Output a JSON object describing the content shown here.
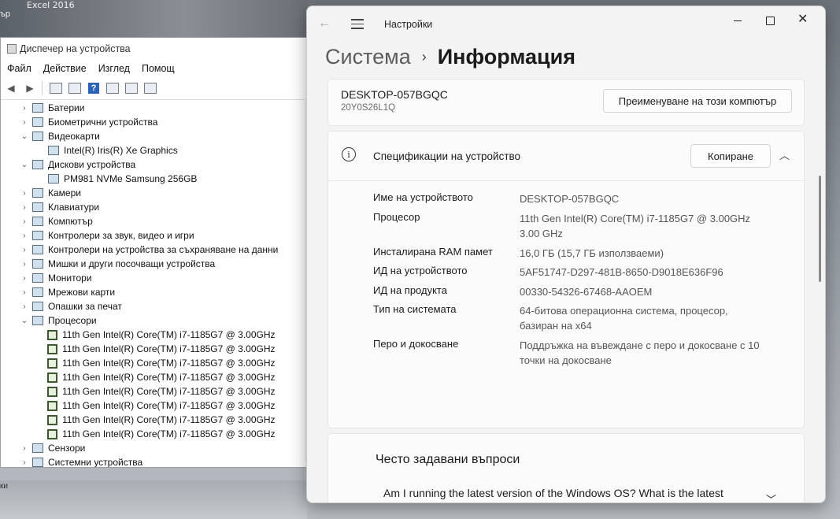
{
  "desktop": {
    "bg_text": "Excel 2016",
    "bg_text2": "ър",
    "bg_text3": "ки"
  },
  "device_manager": {
    "title": "Диспечер на устройства",
    "menu": [
      "Файл",
      "Действие",
      "Изглед",
      "Помощ"
    ],
    "tree": [
      {
        "label": "Батерии",
        "expanded": false,
        "level": 0
      },
      {
        "label": "Биометрични устройства",
        "expanded": false,
        "level": 0
      },
      {
        "label": "Видеокарти",
        "expanded": true,
        "level": 0
      },
      {
        "label": "Intel(R) Iris(R) Xe Graphics",
        "level": 1
      },
      {
        "label": "Дискови устройства",
        "expanded": true,
        "level": 0
      },
      {
        "label": "PM981 NVMe Samsung 256GB",
        "level": 1
      },
      {
        "label": "Камери",
        "expanded": false,
        "level": 0
      },
      {
        "label": "Клавиатури",
        "expanded": false,
        "level": 0
      },
      {
        "label": "Компютър",
        "expanded": false,
        "level": 0
      },
      {
        "label": "Контролери за звук, видео и игри",
        "expanded": false,
        "level": 0
      },
      {
        "label": "Контролери на устройства за съхраняване на данни",
        "expanded": false,
        "level": 0
      },
      {
        "label": "Мишки и други посочващи устройства",
        "expanded": false,
        "level": 0
      },
      {
        "label": "Монитори",
        "expanded": false,
        "level": 0
      },
      {
        "label": "Мрежови карти",
        "expanded": false,
        "level": 0
      },
      {
        "label": "Опашки за печат",
        "expanded": false,
        "level": 0
      },
      {
        "label": "Процесори",
        "expanded": true,
        "level": 0
      },
      {
        "label": "11th Gen Intel(R) Core(TM) i7-1185G7 @ 3.00GHz",
        "level": 1,
        "cpu": true
      },
      {
        "label": "11th Gen Intel(R) Core(TM) i7-1185G7 @ 3.00GHz",
        "level": 1,
        "cpu": true
      },
      {
        "label": "11th Gen Intel(R) Core(TM) i7-1185G7 @ 3.00GHz",
        "level": 1,
        "cpu": true
      },
      {
        "label": "11th Gen Intel(R) Core(TM) i7-1185G7 @ 3.00GHz",
        "level": 1,
        "cpu": true
      },
      {
        "label": "11th Gen Intel(R) Core(TM) i7-1185G7 @ 3.00GHz",
        "level": 1,
        "cpu": true
      },
      {
        "label": "11th Gen Intel(R) Core(TM) i7-1185G7 @ 3.00GHz",
        "level": 1,
        "cpu": true
      },
      {
        "label": "11th Gen Intel(R) Core(TM) i7-1185G7 @ 3.00GHz",
        "level": 1,
        "cpu": true
      },
      {
        "label": "11th Gen Intel(R) Core(TM) i7-1185G7 @ 3.00GHz",
        "level": 1,
        "cpu": true
      },
      {
        "label": "Сензори",
        "expanded": false,
        "level": 0
      },
      {
        "label": "Системни устройства",
        "expanded": false,
        "level": 0
      }
    ]
  },
  "settings": {
    "app_title": "Настройки",
    "breadcrumb_parent": "Система",
    "breadcrumb_sep": "›",
    "breadcrumb_current": "Информация",
    "pc_name": "DESKTOP-057BGQC",
    "pc_model": "20Y0S26L1Q",
    "rename_label": "Преименуване на този компютър",
    "specs_title": "Спецификации на устройство",
    "copy_label": "Копиране",
    "specs": [
      {
        "label": "Име на устройството",
        "value": "DESKTOP-057BGQC"
      },
      {
        "label": "Процесор",
        "value": "11th Gen Intel(R) Core(TM) i7-1185G7 @ 3.00GHz 3.00 GHz"
      },
      {
        "label": "Инсталирана RAM памет",
        "value": "16,0 ГБ (15,7 ГБ използваеми)"
      },
      {
        "label": "ИД на устройството",
        "value": "5AF51747-D297-481B-8650-D9018E636F96"
      },
      {
        "label": "ИД на продукта",
        "value": "00330-54326-67468-AAOEM"
      },
      {
        "label": "Тип на системата",
        "value": "64-битова операционна система, процесор, базиран на x64"
      },
      {
        "label": "Перо и докосване",
        "value": "Поддръжка на въвеждане с перо и докосване с 10 точки на докосване"
      }
    ],
    "faq_title": "Често задавани въпроси",
    "faq_question": "Am I running the latest version of the Windows OS? What is the latest Windows version?"
  }
}
